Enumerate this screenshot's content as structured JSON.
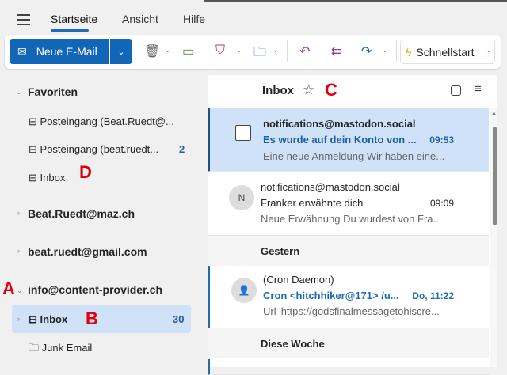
{
  "tabs": [
    "Startseite",
    "Ansicht",
    "Hilfe"
  ],
  "ribbon": {
    "new_mail": "Neue E-Mail",
    "quick_start": "Schnellstart"
  },
  "folders": {
    "favorites_label": "Favoriten",
    "favorites": [
      {
        "label": "Posteingang (Beat.Ruedt@...",
        "count": ""
      },
      {
        "label": "Posteingang (beat.ruedt...",
        "count": "2"
      },
      {
        "label": "Inbox",
        "count": ""
      }
    ],
    "accounts": [
      "Beat.Ruedt@maz.ch",
      "beat.ruedt@gmail.com",
      "info@content-provider.ch"
    ],
    "sub": [
      {
        "label": "Inbox",
        "count": "30"
      },
      {
        "label": "Junk Email",
        "count": ""
      }
    ]
  },
  "annotations": {
    "a": "A",
    "b": "B",
    "c": "C",
    "d": "D"
  },
  "list": {
    "title": "Inbox",
    "messages": [
      {
        "from": "notifications@mastodon.social",
        "subject": "Es wurde auf dein Konto von ...",
        "time": "09:53",
        "preview": "Eine neue Anmeldung Wir haben eine..."
      },
      {
        "from": "notifications@mastodon.social",
        "subject": "Franker erwähnte dich",
        "time": "09:09",
        "preview": "Neue Erwähnung Du wurdest von Fra...",
        "avatar": "N"
      },
      {
        "from": "(Cron Daemon)",
        "subject": "Cron <hitchhiker@171> /u...",
        "time": "Do, 11:22",
        "preview": "Url 'https://godsfinalmessagetohiscre..."
      }
    ],
    "groups": [
      "Gestern",
      "Diese Woche"
    ]
  },
  "colors": {
    "accent": "#1266b8",
    "selected": "#cfe2f8",
    "annotation": "#e0000b"
  }
}
